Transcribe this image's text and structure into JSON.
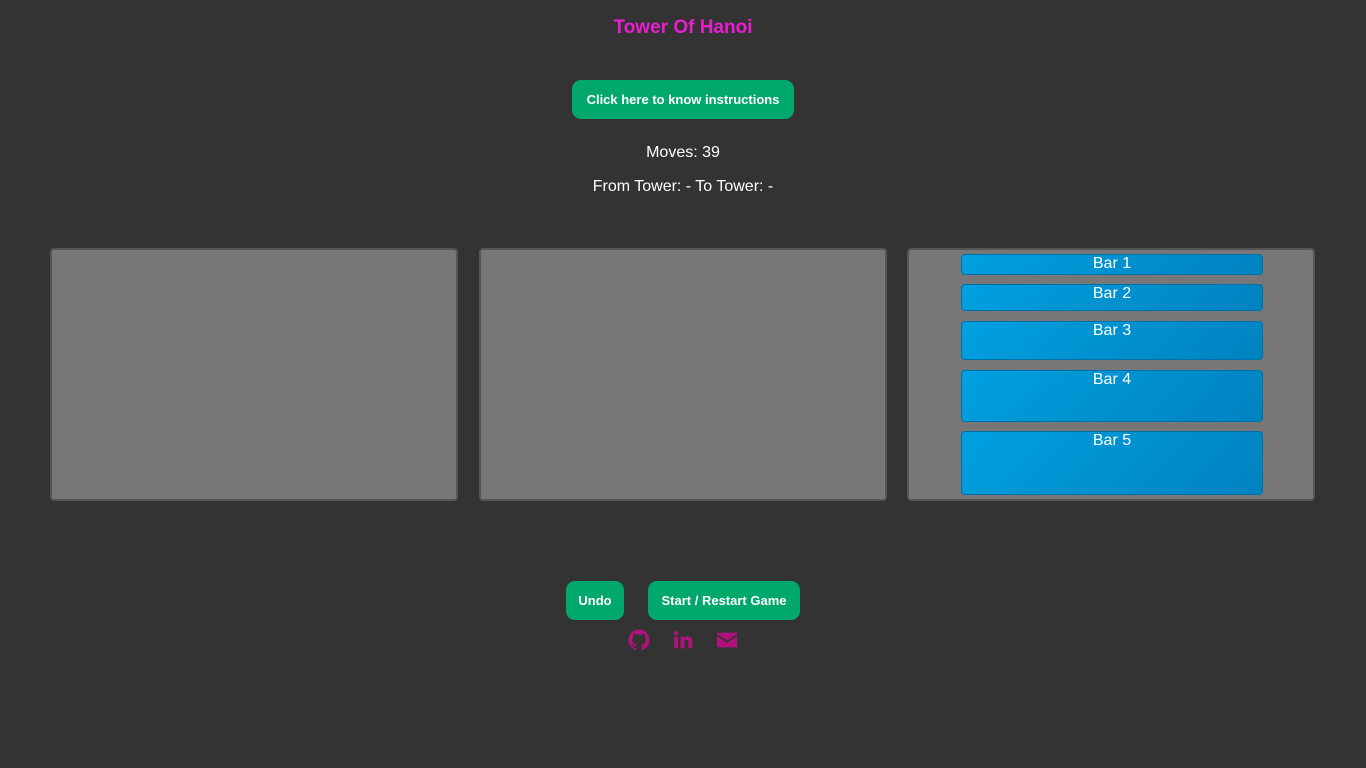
{
  "header": {
    "title": "Tower Of Hanoi",
    "title_color": "#e91ed0"
  },
  "instructions_button": {
    "label": "Click here to know instructions"
  },
  "status": {
    "moves": "Moves: 39",
    "from_to": "From Tower: - To Tower: -"
  },
  "towers": [
    {
      "bars": []
    },
    {
      "bars": []
    },
    {
      "bars": [
        "Bar 1",
        "Bar 2",
        "Bar 3",
        "Bar 4",
        "Bar 5"
      ]
    }
  ],
  "controls": {
    "undo_label": "Undo",
    "restart_label": "Start / Restart Game"
  },
  "social_links": [
    {
      "icon": "github-icon"
    },
    {
      "icon": "linkedin-icon"
    },
    {
      "icon": "mail-icon"
    }
  ],
  "colors": {
    "background": "#333333",
    "button": "#00a86b",
    "tower": "#777777",
    "bar": "#0096d6",
    "social_icon": "#b0127d"
  }
}
